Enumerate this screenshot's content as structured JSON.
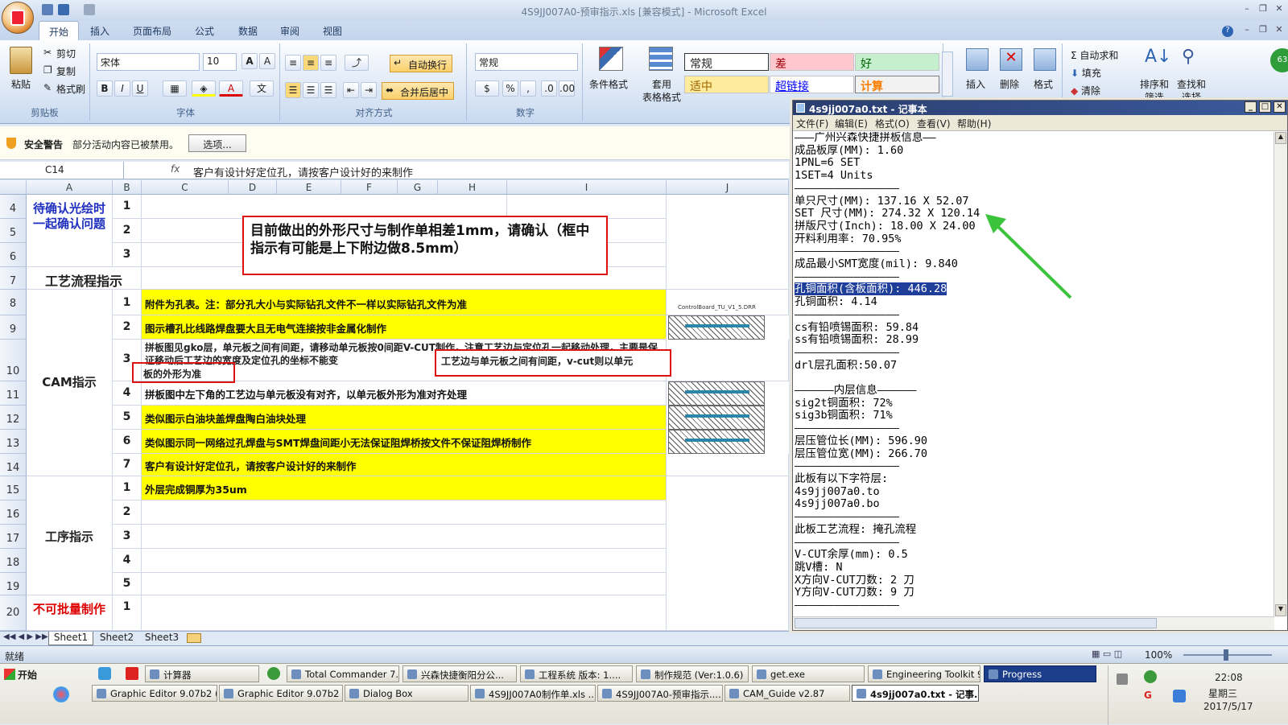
{
  "window": {
    "title": "4S9JJ007A0-预审指示.xls  [兼容模式] - Microsoft Excel"
  },
  "ribbon_tabs": [
    "开始",
    "插入",
    "页面布局",
    "公式",
    "数据",
    "审阅",
    "视图"
  ],
  "clipboard": {
    "paste": "粘贴",
    "cut": "剪切",
    "copy": "复制",
    "format_painter": "格式刷",
    "label": "剪贴板"
  },
  "font": {
    "name": "宋体",
    "size": "10",
    "label": "字体",
    "bold": "B",
    "italic": "I",
    "underline": "U"
  },
  "alignment": {
    "wrap": "自动换行",
    "merge": "合并后居中",
    "label": "对齐方式"
  },
  "number": {
    "format": "常规",
    "pct": "%",
    "comma": ",",
    "label": "数字"
  },
  "styles": {
    "cond": "条件格式",
    "table_l1": "套用",
    "table_l2": "表格格式",
    "normal": "常规",
    "bad": "差",
    "good": "好",
    "neutral": "适中",
    "hyperlink": "超链接",
    "calc": "计算",
    "label": "样式"
  },
  "cells_grp": {
    "insert": "插入",
    "delete": "删除",
    "format": "格式"
  },
  "editing": {
    "autosum": "自动求和",
    "fill": "填充",
    "clear": "清除",
    "sort": "排序和",
    "find": "查找和",
    "sort2": "筛选",
    "find2": "选择"
  },
  "security": {
    "title": "安全警告",
    "msg": "部分活动内容已被禁用。",
    "button": "选项..."
  },
  "formula": {
    "namebox": "C14",
    "fx": "fx",
    "content": "客户有设计好定位孔，请按客户设计好的来制作"
  },
  "columns": [
    "A",
    "B",
    "C",
    "D",
    "E",
    "F",
    "G",
    "H",
    "I",
    "J"
  ],
  "rows": [
    "4",
    "5",
    "6",
    "7",
    "8",
    "9",
    "10",
    "11",
    "12",
    "13",
    "14",
    "15",
    "16",
    "17",
    "18",
    "19",
    "20"
  ],
  "sheet": {
    "confirm_label": "待确认光绘时一起确认问题",
    "process_label": "工艺流程指示",
    "cam_label": "CAM指示",
    "step_label": "工序指示",
    "nomass_label": "不可批量制作",
    "nums": [
      "1",
      "2",
      "3",
      "1",
      "2",
      "3",
      "4",
      "5",
      "6",
      "7",
      "1",
      "2",
      "3",
      "4",
      "5",
      "1"
    ],
    "cam_items": [
      "附件为孔表。注：部分孔大小与实际钻孔文件不一样以实际钻孔文件为准",
      "图示槽孔比线路焊盘要大且无电气连接按非金属化制作",
      "拼板图见gko层，单元板之间有间距，请移动单元板按0间距V-CUT制作，注意工艺边与定位孔一起移动处理，主要是保证移动后工艺边的宽度及定位孔的坐标不能变",
      "拼板图中左下角的工艺边与单元板没有对齐，以单元板外形为准对齐处理",
      "类似图示白油块盖焊盘陶白油块处理",
      "类似图示同一网络过孔焊盘与SMT焊盘间距小无法保证阻焊桥按文件不保证阻焊桥制作",
      "客户有设计好定位孔，请按客户设计好的来制作"
    ],
    "step_item": "外层完成铜厚为35um",
    "callout": "目前做出的外形尺寸与制作单相差1mm，请确认（框中指示有可能是上下附边做8.5mm）",
    "note_box": "工艺边与单元板之间有间距，v-cut则以单元",
    "note_cont": "板的外形为准",
    "attach": "ControlBoard_TU_V1_5.DRR"
  },
  "sheet_tabs": [
    "Sheet1",
    "Sheet2",
    "Sheet3"
  ],
  "status": {
    "ready": "就绪",
    "zoom": "100%"
  },
  "notepad": {
    "title": "4s9jj007a0.txt - 记事本",
    "menu": [
      "文件(F)",
      "编辑(E)",
      "格式(O)",
      "查看(V)",
      "帮助(H)"
    ],
    "lines_before": [
      "———广州兴森快捷拼板信息——",
      "成品板厚(MM): 1.60",
      "1PNL=6 SET",
      "1SET=4 Units",
      "————————————————",
      "单只尺寸(MM): 137.16 X 52.07",
      "SET 尺寸(MM): 274.32 X 120.14",
      "拼版尺寸(Inch): 18.00 X 24.00",
      "开料利用率: 70.95%",
      "————————————————",
      "成品最小SMT宽度(mil): 9.840",
      "————————————————"
    ],
    "highlight": "孔铜面积(含板面积): 446.28",
    "lines_after": [
      "孔铜面积: 4.14",
      "————————————————",
      "cs有铅喷锡面积: 59.84",
      "ss有铅喷锡面积: 28.99",
      "————————————————",
      "drl层孔面积:50.07",
      "",
      "——————内层信息——————",
      "sig2t铜面积: 72%",
      "sig3b铜面积: 71%",
      "————————————————",
      "层压管位长(MM): 596.90",
      "层压管位宽(MM): 266.70",
      "————————————————",
      "此板有以下字符层:",
      "4s9jj007a0.to",
      "4s9jj007a0.bo",
      "————————————————",
      "此板工艺流程: 掩孔流程",
      "————————————————",
      "V-CUT余厚(mm): 0.5",
      "跳V槽: N",
      "X方向V-CUT刀数: 2 刀",
      "Y方向V-CUT刀数: 9 刀",
      "————————————————"
    ]
  },
  "taskbar": {
    "start": "开始",
    "row1": [
      "计算器",
      "Total Commander 7.0...",
      "兴森快捷衡阳分公...",
      "工程系统  版本: 1....",
      "制作规范 (Ver:1.0.6)",
      "get.exe",
      "Engineering Toolkit 9....",
      "Progress"
    ],
    "row2": [
      "Graphic Editor 9.07b2 (0...",
      "Graphic Editor 9.07b2 (0...",
      "Dialog Box",
      "4S9JJ007A0制作单.xls ...",
      "4S9JJ007A0-预审指示....",
      "CAM_Guide v2.87",
      "4s9jj007a0.txt - 记事..."
    ],
    "time": "22:08",
    "day": "星期三",
    "date": "2017/5/17"
  }
}
